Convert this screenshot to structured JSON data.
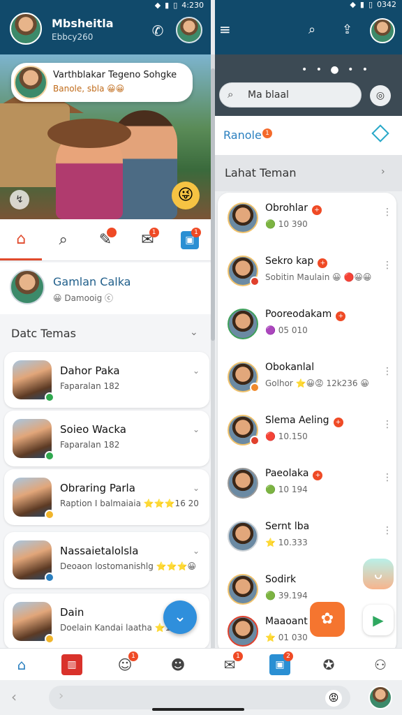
{
  "status": {
    "left_time": "4:230",
    "right_time": "0342"
  },
  "left_header": {
    "title": "Mbsheitla",
    "subtitle": "Ebbcy260"
  },
  "hero": {
    "bubble_title": "Varthblakar Tegeno Sohgke",
    "bubble_sub": "Banole, sbla 😀😀",
    "emoji": "😜",
    "mini_icon": "↯"
  },
  "left_tabs": [
    {
      "icon": "⌂",
      "badge": ""
    },
    {
      "icon": "⌕",
      "badge": ""
    },
    {
      "icon": "✎",
      "badge": ""
    },
    {
      "icon": "✉",
      "badge": "1"
    },
    {
      "icon": "▣",
      "badge": "1"
    }
  ],
  "profile": {
    "name": "Gamlan Calka",
    "status": "😀 Damooig ⓒ"
  },
  "left_section": {
    "title": "Datc Temas",
    "chevron": "⌄"
  },
  "left_list": [
    {
      "name": "Dahor Paka",
      "sub": "Faparalan 182"
    },
    {
      "name": "Soieo Wacka",
      "sub": "Faparalan 182"
    },
    {
      "name": "Obraring Parla",
      "sub": "Raption I balmaiaia ⭐⭐⭐16 20"
    },
    {
      "name": "Nassaietalolsla",
      "sub": "Deoaon lostomanishlg ⭐⭐⭐😀"
    },
    {
      "name": "Dain",
      "sub": "Doelain Kandai laatha ⭐1 24"
    }
  ],
  "fab_icon": "⌄",
  "right_header": {
    "menu_icon": "≡",
    "search_icon": "⌕",
    "share_icon": "⇪"
  },
  "right_search": {
    "placeholder": "Ma blaal",
    "dots": "• • ● • •",
    "cam": "◎"
  },
  "right_tab": {
    "name": "Ranole",
    "badge": "1"
  },
  "right_section": {
    "title": "Lahat Teman",
    "chevron": "›"
  },
  "right_list": [
    {
      "name": "Obrohlar",
      "badge": "+",
      "sub": "🟢 10 390",
      "more": "⋮"
    },
    {
      "name": "Sekro kap",
      "badge": "+",
      "sub": "Sobitin Maulain 😀 🔴😀😀",
      "more": "⋮"
    },
    {
      "name": "Pooreodakam",
      "badge": "+",
      "sub": "🟣 05 010",
      "more": ""
    },
    {
      "name": "Obokanlal",
      "badge": "",
      "sub": "Golhor ⭐😀😡 12k236 😀",
      "more": "⋮"
    },
    {
      "name": "Slema Aeling",
      "badge": "+",
      "sub": "🔴 10.150",
      "more": "⋮"
    },
    {
      "name": "Paeolaka",
      "badge": "+",
      "sub": "🟢 10 194",
      "more": "⋮"
    },
    {
      "name": "Sernt lba",
      "badge": "",
      "sub": "⭐ 10.333",
      "more": "⋮"
    },
    {
      "name": "Sodirk",
      "badge": "",
      "sub": "🟢 39.194",
      "more": ""
    },
    {
      "name": "Maaoant",
      "badge": "",
      "sub": "⭐ 01 030",
      "more": ""
    }
  ],
  "floating": {
    "a": "ᴗ",
    "b": "✿",
    "c": "▶"
  },
  "bottom_nav": [
    {
      "icon": "⌂",
      "badge": ""
    },
    {
      "icon": "▥",
      "badge": ""
    },
    {
      "icon": "☺",
      "badge": "1"
    },
    {
      "icon": "☻",
      "badge": ""
    },
    {
      "icon": "✉",
      "badge": "1"
    },
    {
      "icon": "▣",
      "badge": "2"
    },
    {
      "icon": "✪",
      "badge": ""
    },
    {
      "icon": "⚇",
      "badge": ""
    }
  ],
  "sysbar": {
    "back": "‹",
    "forward": "›",
    "emoji": "😡"
  }
}
